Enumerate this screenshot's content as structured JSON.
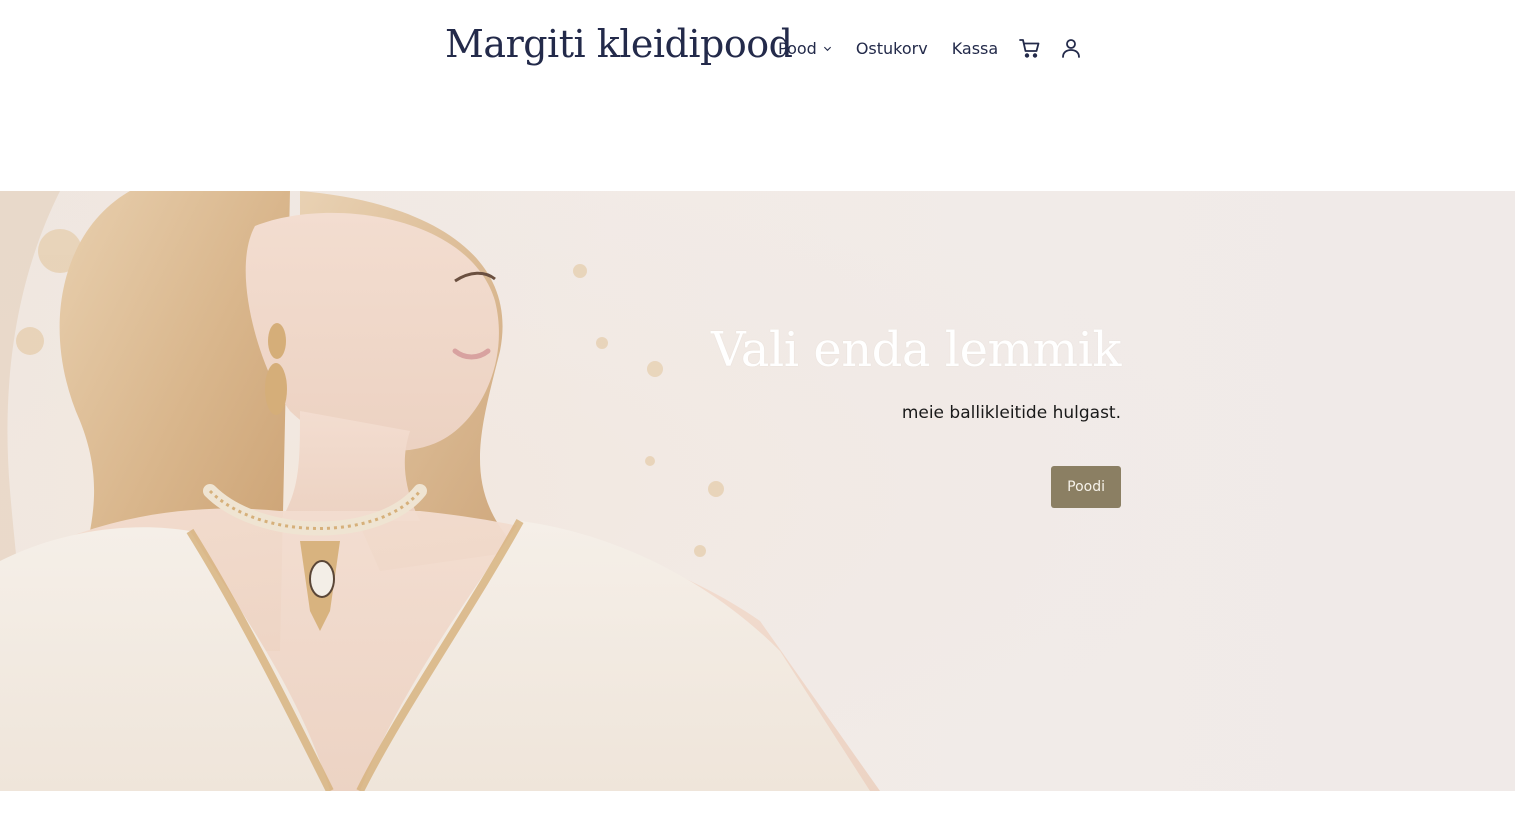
{
  "header": {
    "site_title": "Margiti kleidipood",
    "nav": {
      "shop_label": "Pood",
      "cart_label": "Ostukorv",
      "checkout_label": "Kassa"
    },
    "icons": [
      "chevron-down-icon",
      "shopping-cart-icon",
      "user-account-icon"
    ]
  },
  "hero": {
    "title": "Vali enda lemmik",
    "subtitle": "meie ballikleitide hulgast.",
    "button_label": "Poodi"
  },
  "colors": {
    "brand_text": "#232a4a",
    "button_bg": "#8b7f63",
    "hero_bg": "#f1ebe7"
  }
}
